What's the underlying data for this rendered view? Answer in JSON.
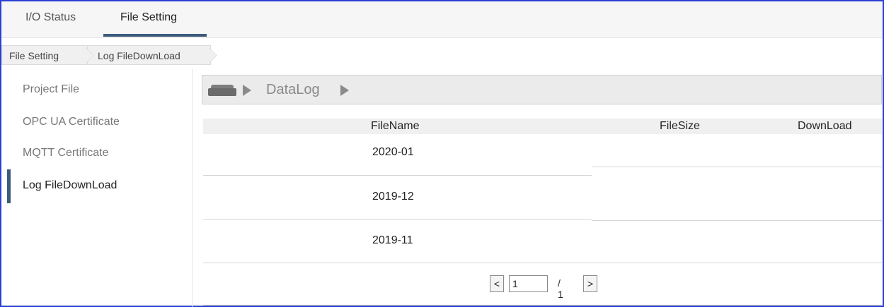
{
  "tabs": [
    {
      "label": "I/O Status"
    },
    {
      "label": "File Setting"
    }
  ],
  "breadcrumb": [
    "File Setting",
    "Log FileDownLoad"
  ],
  "sidebar": {
    "items": [
      {
        "label": "Project File"
      },
      {
        "label": "OPC UA Certificate"
      },
      {
        "label": "MQTT Certificate"
      },
      {
        "label": "Log FileDownLoad"
      }
    ],
    "active_index": 3
  },
  "path": {
    "icon": "drive-icon",
    "folder": "DataLog"
  },
  "table": {
    "columns": [
      "FileName",
      "FileSize",
      "DownLoad"
    ],
    "rows": [
      {
        "name": "2020-01"
      },
      {
        "name": "2019-12"
      },
      {
        "name": "2019-11"
      }
    ]
  },
  "pager": {
    "prev_label": "<",
    "next_label": ">",
    "current_page": "1",
    "total": "/ 1"
  },
  "colors": {
    "frame_border": "#2b3fd6",
    "accent": "#3c5b7c"
  }
}
